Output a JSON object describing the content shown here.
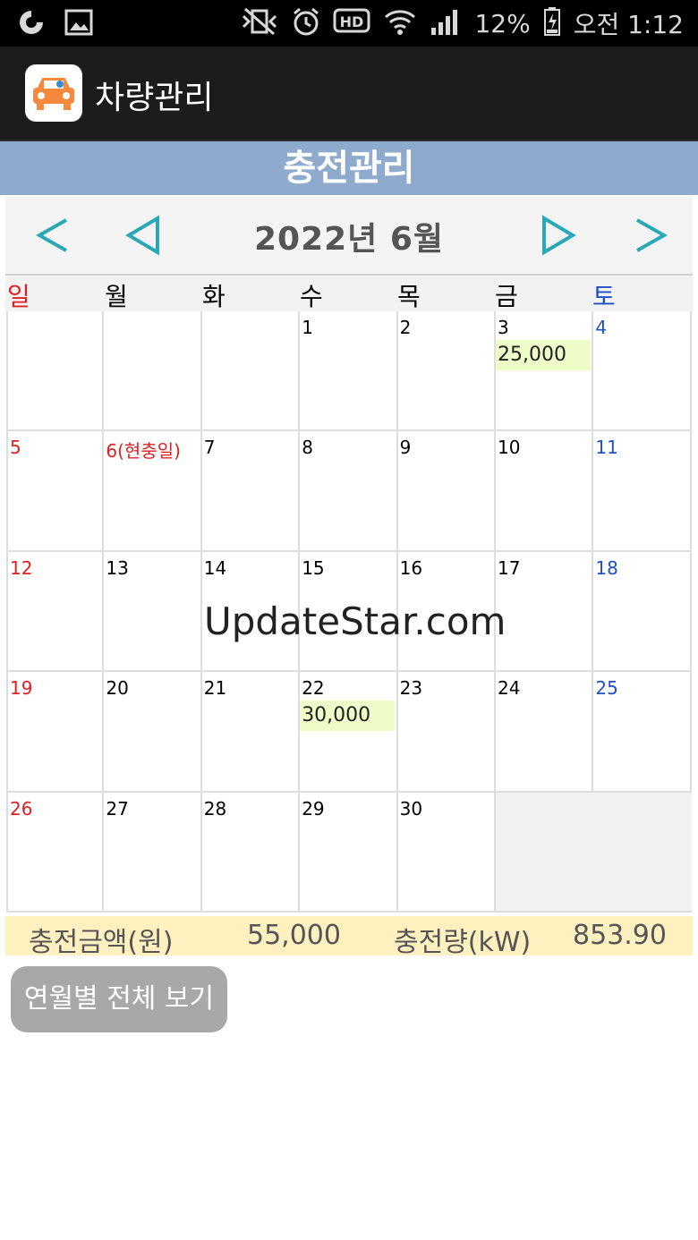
{
  "status_bar": {
    "battery": "12%",
    "time": "오전 1:12"
  },
  "app": {
    "title": "차량관리"
  },
  "page": {
    "header": "충전관리"
  },
  "calendar": {
    "month_label": "2022년  6월",
    "weekdays": [
      "일",
      "월",
      "화",
      "수",
      "목",
      "금",
      "토"
    ],
    "weeks": [
      [
        {
          "day": ""
        },
        {
          "day": ""
        },
        {
          "day": ""
        },
        {
          "day": "1"
        },
        {
          "day": "2"
        },
        {
          "day": "3",
          "amount": "25,000"
        },
        {
          "day": "4"
        }
      ],
      [
        {
          "day": "5"
        },
        {
          "day": "6(현충일)"
        },
        {
          "day": "7"
        },
        {
          "day": "8"
        },
        {
          "day": "9"
        },
        {
          "day": "10"
        },
        {
          "day": "11"
        }
      ],
      [
        {
          "day": "12"
        },
        {
          "day": "13"
        },
        {
          "day": "14"
        },
        {
          "day": "15"
        },
        {
          "day": "16"
        },
        {
          "day": "17"
        },
        {
          "day": "18"
        }
      ],
      [
        {
          "day": "19"
        },
        {
          "day": "20"
        },
        {
          "day": "21"
        },
        {
          "day": "22",
          "amount": "30,000"
        },
        {
          "day": "23"
        },
        {
          "day": "24"
        },
        {
          "day": "25"
        }
      ],
      [
        {
          "day": "26"
        },
        {
          "day": "27"
        },
        {
          "day": "28"
        },
        {
          "day": "29"
        },
        {
          "day": "30"
        },
        {
          "day": "",
          "empty": true
        },
        {
          "day": "",
          "empty": true
        }
      ]
    ]
  },
  "watermark": "UpdateStar.com",
  "summary": {
    "amount_label": "충전금액(원)",
    "amount_value": "55,000",
    "energy_label": "충전량(kW)",
    "energy_value": "853.90"
  },
  "buttons": {
    "view_all": "연월별 전체 보기"
  },
  "colors": {
    "header_bg": "#8eaacc",
    "nav_arrow": "#2aa8b8",
    "sunday": "#e02020",
    "saturday": "#1e50c8",
    "amount_highlight": "#eefcc8",
    "summary_bg": "#fff0c0"
  }
}
